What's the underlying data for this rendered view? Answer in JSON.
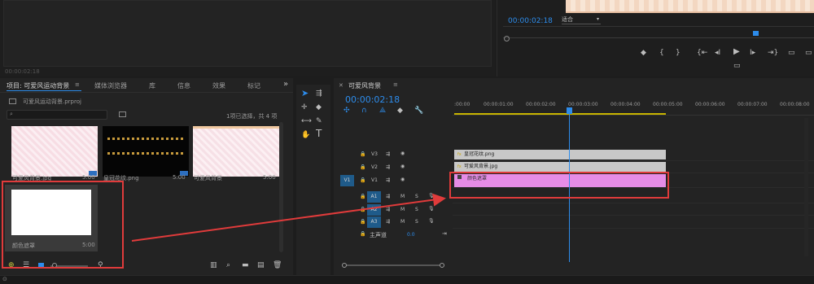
{
  "source": {
    "timecode_left": "00:00:02:18"
  },
  "program": {
    "timecode": "00:00:02:18",
    "fit_label": "适合"
  },
  "project": {
    "tabs": [
      "项目: 可爱风运动背景",
      "媒体浏览器",
      "库",
      "信息",
      "效果",
      "标记"
    ],
    "more": "»",
    "file_name": "可爱风运动背景.prproj",
    "selection_info": "1项已选择，共 4 项",
    "items": [
      {
        "name": "可爱风背景.jpg",
        "duration": "5:00"
      },
      {
        "name": "皇冠花纹.png",
        "duration": "5:00"
      },
      {
        "name": "可爱风背景",
        "duration": "5:00"
      },
      {
        "name": "颜色遮罩",
        "duration": "5:00"
      }
    ]
  },
  "timeline": {
    "tab_label": "可爱风背景",
    "timecode": "00:00:02:18",
    "ruler": [
      ":00:00",
      "00:00:01:00",
      "00:00:02:00",
      "00:00:03:00",
      "00:00:04:00",
      "00:00:05:00",
      "00:00:06:00",
      "00:00:07:00",
      "00:00:08:00"
    ],
    "video_tracks": [
      "V3",
      "V2",
      "V1"
    ],
    "source_patch_v": "V1",
    "audio_tracks": [
      "A1",
      "A2",
      "A3"
    ],
    "mute": "M",
    "solo": "S",
    "master_label": "主声道",
    "master_value": "0.0",
    "clips": [
      "皇冠花纹.png",
      "可爱风背景.jpg",
      "颜色遮罩"
    ],
    "clip_fx": "fx"
  },
  "colors": {
    "accent": "#2d8ceb",
    "annotation": "#e03b3b",
    "clip_gray": "#c8c8c8",
    "clip_pink": "#e68ce6",
    "playhead": "#2d8ceb",
    "track_target": "#1f5b8a"
  }
}
